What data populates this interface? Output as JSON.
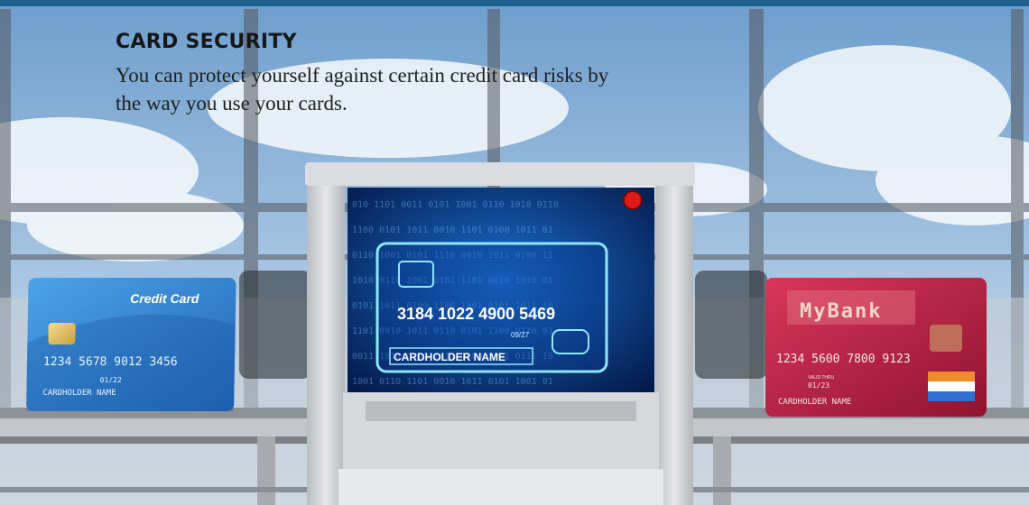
{
  "heading": "CARD SECURITY",
  "intro": "You can protect yourself against certain credit card risks by the way you use your cards.",
  "cards": {
    "left": {
      "label": "Credit Card",
      "number": "1234 5678 9012 3456",
      "expiry": "01/22",
      "holder": "CARDHOLDER NAME",
      "color": "#2f80cf"
    },
    "screen": {
      "number": "3184 1022 4900 5469",
      "expiry": "09/27",
      "holder": "CARDHOLDER NAME",
      "glow": "#8fe6ff"
    },
    "right": {
      "bank": "MyBank",
      "number": "1234  5600  7800  9123",
      "valid_thru": "VALID THRU",
      "expiry": "01/23",
      "holder": "CARDHOLDER NAME",
      "color": "#b8203f"
    }
  },
  "colors": {
    "top_bar": "#1d5f8f",
    "indicator_light": "#e01818"
  }
}
